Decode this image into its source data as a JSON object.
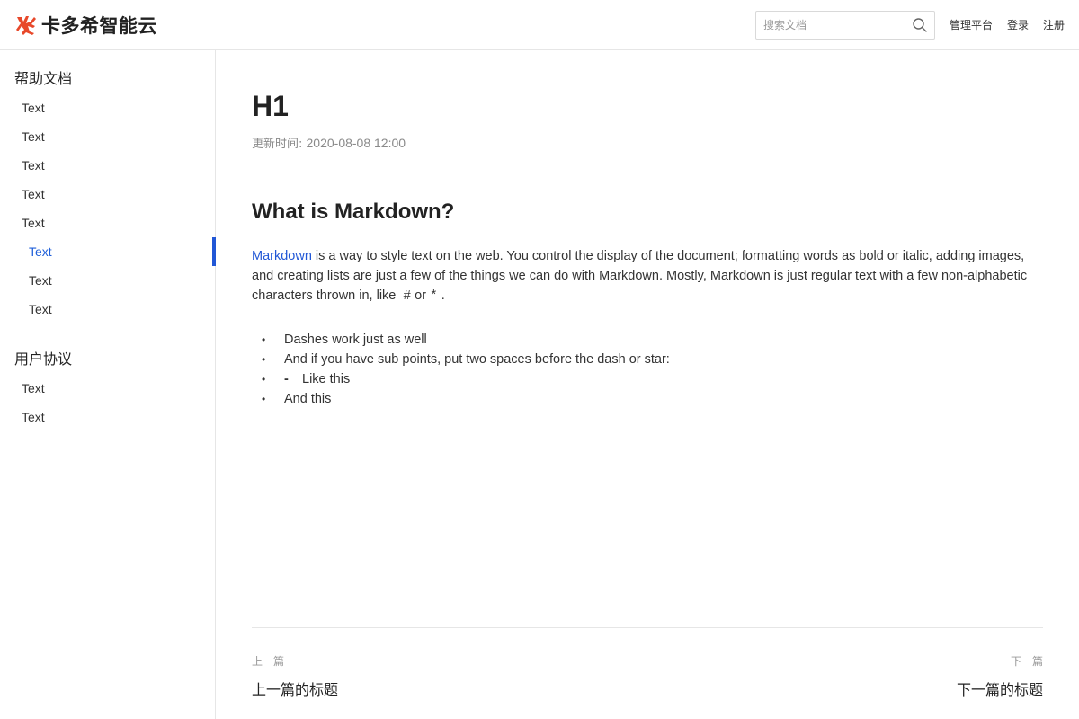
{
  "header": {
    "brand": "卡多希智能云",
    "brand_color": "#e8482a",
    "search": {
      "placeholder": "搜索文档",
      "value": "",
      "icon": "search-icon"
    },
    "nav": {
      "manage": "管理平台",
      "login": "登录",
      "register": "注册"
    }
  },
  "sidebar": {
    "accent_color": "#2157d6",
    "sections": [
      {
        "title": "帮助文档",
        "items": [
          {
            "label": "Text"
          },
          {
            "label": "Text"
          },
          {
            "label": "Text"
          },
          {
            "label": "Text"
          },
          {
            "label": "Text"
          },
          {
            "label": "Text",
            "active": true
          },
          {
            "label": "Text"
          },
          {
            "label": "Text"
          }
        ]
      },
      {
        "title": "用户协议",
        "items": [
          {
            "label": "Text"
          },
          {
            "label": "Text"
          }
        ]
      }
    ]
  },
  "article": {
    "title": "H1",
    "updated_label": "更新时间: ",
    "updated_value": "2020-08-08 12:00",
    "heading": "What is Markdown?",
    "link_text": "Markdown",
    "link_color": "#2157d6",
    "body_part1": " is a way to style text on the web. You control the display of the document; formatting words as bold or italic, adding images, and creating lists are just a few of the things we can do with Markdown. Mostly, Markdown is just regular text with a few non-alphabetic characters thrown in, like ",
    "code1": "#",
    "body_part2": "or",
    "code2": "*",
    "body_part3": ".",
    "list": [
      {
        "bullet": "•",
        "text": "Dashes work just as well"
      },
      {
        "bullet": "•",
        "text": "And if you have sub points, put two spaces before the dash or star:"
      },
      {
        "bullet": "•",
        "dash": "-",
        "text": "Like this"
      },
      {
        "bullet": "•",
        "text": "And this"
      }
    ]
  },
  "pager": {
    "prev_label": "上一篇",
    "prev_title": "上一篇的标题",
    "next_label": "下一篇",
    "next_title": "下一篇的标题"
  }
}
